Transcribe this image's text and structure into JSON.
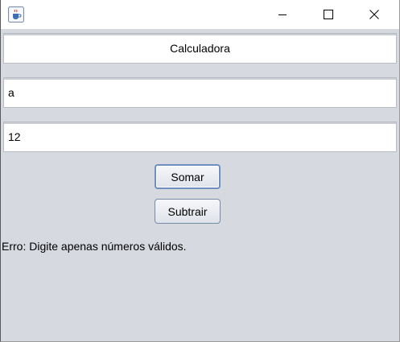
{
  "window": {
    "icon": "java-coffee-cup-icon",
    "controls": {
      "minimize": "minimize-icon",
      "maximize": "maximize-icon",
      "close": "close-icon"
    }
  },
  "form": {
    "title": "Calculadora",
    "first_value": "a",
    "second_value": "12",
    "add_label": "Somar",
    "subtract_label": "Subtrair",
    "message": "Erro: Digite apenas números válidos."
  },
  "colors": {
    "background": "#d6d9df",
    "field_background": "#ffffff",
    "focus_border": "#6f8fc0"
  }
}
